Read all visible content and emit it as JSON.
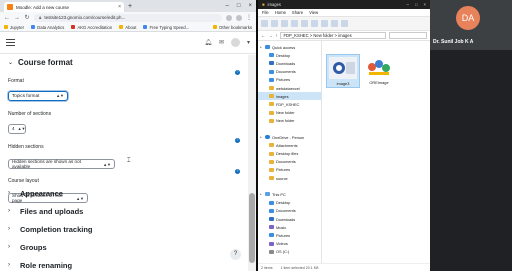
{
  "browser": {
    "tab_title": "Moodle: Add a new course",
    "url": "testsite123.gnomio.com/course/edit.ph...",
    "bookmarks": [
      {
        "label": "Jupyter"
      },
      {
        "label": "Data Analytics"
      },
      {
        "label": "AKG Accreditation"
      },
      {
        "label": "About"
      },
      {
        "label": "Free Typing Speed..."
      }
    ],
    "bookmarks_more": "Other bookmarks"
  },
  "form": {
    "section_title": "Course format",
    "format": {
      "label": "Format",
      "value": "Topics format"
    },
    "sections": {
      "label": "Number of sections",
      "value": "4"
    },
    "hidden": {
      "label": "Hidden sections",
      "value": "Hidden sections are shown as not available"
    },
    "layout": {
      "label": "Course layout",
      "value": "Show all sections on one page"
    },
    "collapsed": [
      {
        "title": "Appearance"
      },
      {
        "title": "Files and uploads"
      },
      {
        "title": "Completion tracking"
      },
      {
        "title": "Groups"
      },
      {
        "title": "Role renaming"
      }
    ],
    "help_glyph": "?",
    "fab_glyph": "?"
  },
  "explorer": {
    "title": "images",
    "menu": [
      "File",
      "Home",
      "Share",
      "View"
    ],
    "path": "FDP_KSHEC > New folder > images",
    "nav_items": [
      {
        "label": "Quick access",
        "icon": "star-icon",
        "level": 0
      },
      {
        "label": "Desktop",
        "icon": "desktop-icon",
        "level": 1
      },
      {
        "label": "Downloads",
        "icon": "downloads-icon",
        "level": 1
      },
      {
        "label": "Documents",
        "icon": "documents-icon",
        "level": 1
      },
      {
        "label": "Pictures",
        "icon": "pictures-icon",
        "level": 1
      },
      {
        "label": "webdataexcel",
        "icon": "folder-icon",
        "level": 1
      },
      {
        "label": "images",
        "icon": "folder-icon",
        "level": 1
      },
      {
        "label": "FDP_KSHEC",
        "icon": "folder-icon",
        "level": 1
      },
      {
        "label": "New folder",
        "icon": "folder-icon",
        "level": 1
      },
      {
        "label": "New folder",
        "icon": "folder-icon",
        "level": 1
      },
      {
        "label": "",
        "icon": "",
        "level": 0
      },
      {
        "label": "OneDrive - Person",
        "icon": "onedrive-icon",
        "level": 0
      },
      {
        "label": "Attachments",
        "icon": "folder-icon",
        "level": 1
      },
      {
        "label": "Desktop files",
        "icon": "folder-icon",
        "level": 1
      },
      {
        "label": "Documents",
        "icon": "folder-icon",
        "level": 1
      },
      {
        "label": "Pictures",
        "icon": "folder-icon",
        "level": 1
      },
      {
        "label": "source",
        "icon": "folder-icon",
        "level": 1
      },
      {
        "label": "",
        "icon": "",
        "level": 0
      },
      {
        "label": "This PC",
        "icon": "pc-icon",
        "level": 0
      },
      {
        "label": "Desktop",
        "icon": "desktop-icon",
        "level": 1
      },
      {
        "label": "Documents",
        "icon": "documents-icon",
        "level": 1
      },
      {
        "label": "Downloads",
        "icon": "downloads-icon",
        "level": 1
      },
      {
        "label": "Music",
        "icon": "music-icon",
        "level": 1
      },
      {
        "label": "Pictures",
        "icon": "pictures-icon",
        "level": 1
      },
      {
        "label": "Videos",
        "icon": "videos-icon",
        "level": 1
      },
      {
        "label": "OS (C:)",
        "icon": "drive-icon",
        "level": 1
      }
    ],
    "files": [
      {
        "name": "image3",
        "selected": true
      },
      {
        "name": "OREImage",
        "selected": false
      }
    ],
    "status": [
      "2 items",
      "1 item selected  20.1 KB"
    ]
  },
  "video": {
    "initials": "DA",
    "presenter": "Dr. Sunil Job K A",
    "avatar_color": "#e8825a"
  },
  "colors": {
    "moodle_blue": "#0f6cbf",
    "folder_yellow": "#e8b338"
  }
}
